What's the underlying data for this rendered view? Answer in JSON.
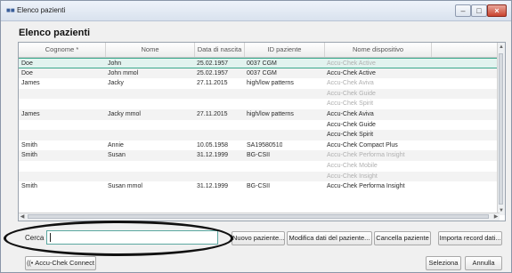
{
  "window": {
    "title": "Elenco pazienti",
    "icon": "patients-icon"
  },
  "heading": "Elenco pazienti",
  "table": {
    "columns": [
      "Cognome *",
      "Nome",
      "Data di nascita",
      "ID paziente",
      "Nome dispositivo"
    ],
    "rows": [
      {
        "cognome": "Doe",
        "nome": "John",
        "data": "25.02.1957",
        "id": "0037 CGM",
        "device": "Accu-Chek Active",
        "device_dim": true,
        "selected": true
      },
      {
        "cognome": "Doe",
        "nome": "John mmol",
        "data": "25.02.1957",
        "id": "0037 CGM",
        "device": "Accu-Chek Active",
        "device_dim": false,
        "selected": false
      },
      {
        "cognome": "James",
        "nome": "Jacky",
        "data": "27.11.2015",
        "id": "high/low patterns",
        "device": "Accu-Chek Aviva",
        "device_dim": true,
        "selected": false
      },
      {
        "cognome": "",
        "nome": "",
        "data": "",
        "id": "",
        "device": "Accu-Chek Guide",
        "device_dim": true,
        "selected": false
      },
      {
        "cognome": "",
        "nome": "",
        "data": "",
        "id": "",
        "device": "Accu-Chek Spirit",
        "device_dim": true,
        "selected": false
      },
      {
        "cognome": "James",
        "nome": "Jacky mmol",
        "data": "27.11.2015",
        "id": "high/low patterns",
        "device": "Accu-Chek Aviva",
        "device_dim": false,
        "selected": false
      },
      {
        "cognome": "",
        "nome": "",
        "data": "",
        "id": "",
        "device": "Accu-Chek Guide",
        "device_dim": false,
        "selected": false
      },
      {
        "cognome": "",
        "nome": "",
        "data": "",
        "id": "",
        "device": "Accu-Chek Spirit",
        "device_dim": false,
        "selected": false
      },
      {
        "cognome": "Smith",
        "nome": "Annie",
        "data": "10.05.1958",
        "id": "SA19580510",
        "device": "Accu-Chek Compact Plus",
        "device_dim": false,
        "selected": false
      },
      {
        "cognome": "Smith",
        "nome": "Susan",
        "data": "31.12.1999",
        "id": "BG-CSII",
        "device": "Accu-Chek Performa Insight",
        "device_dim": true,
        "selected": false
      },
      {
        "cognome": "",
        "nome": "",
        "data": "",
        "id": "",
        "device": "Accu-Chek Mobile",
        "device_dim": true,
        "selected": false
      },
      {
        "cognome": "",
        "nome": "",
        "data": "",
        "id": "",
        "device": "Accu-Chek Insight",
        "device_dim": true,
        "selected": false
      },
      {
        "cognome": "Smith",
        "nome": "Susan mmol",
        "data": "31.12.1999",
        "id": "BG-CSII",
        "device": "Accu-Chek Performa Insight",
        "device_dim": false,
        "selected": false
      }
    ]
  },
  "search": {
    "label": "Cerca",
    "value": ""
  },
  "buttons": {
    "new_patient": "Nuovo paziente...",
    "edit_patient": "Modifica dati del paziente...",
    "delete_patient": "Cancella paziente",
    "import": "Importa record dati...",
    "connect": "Accu-Chek Connect",
    "select": "Seleziona",
    "cancel": "Annulla"
  }
}
